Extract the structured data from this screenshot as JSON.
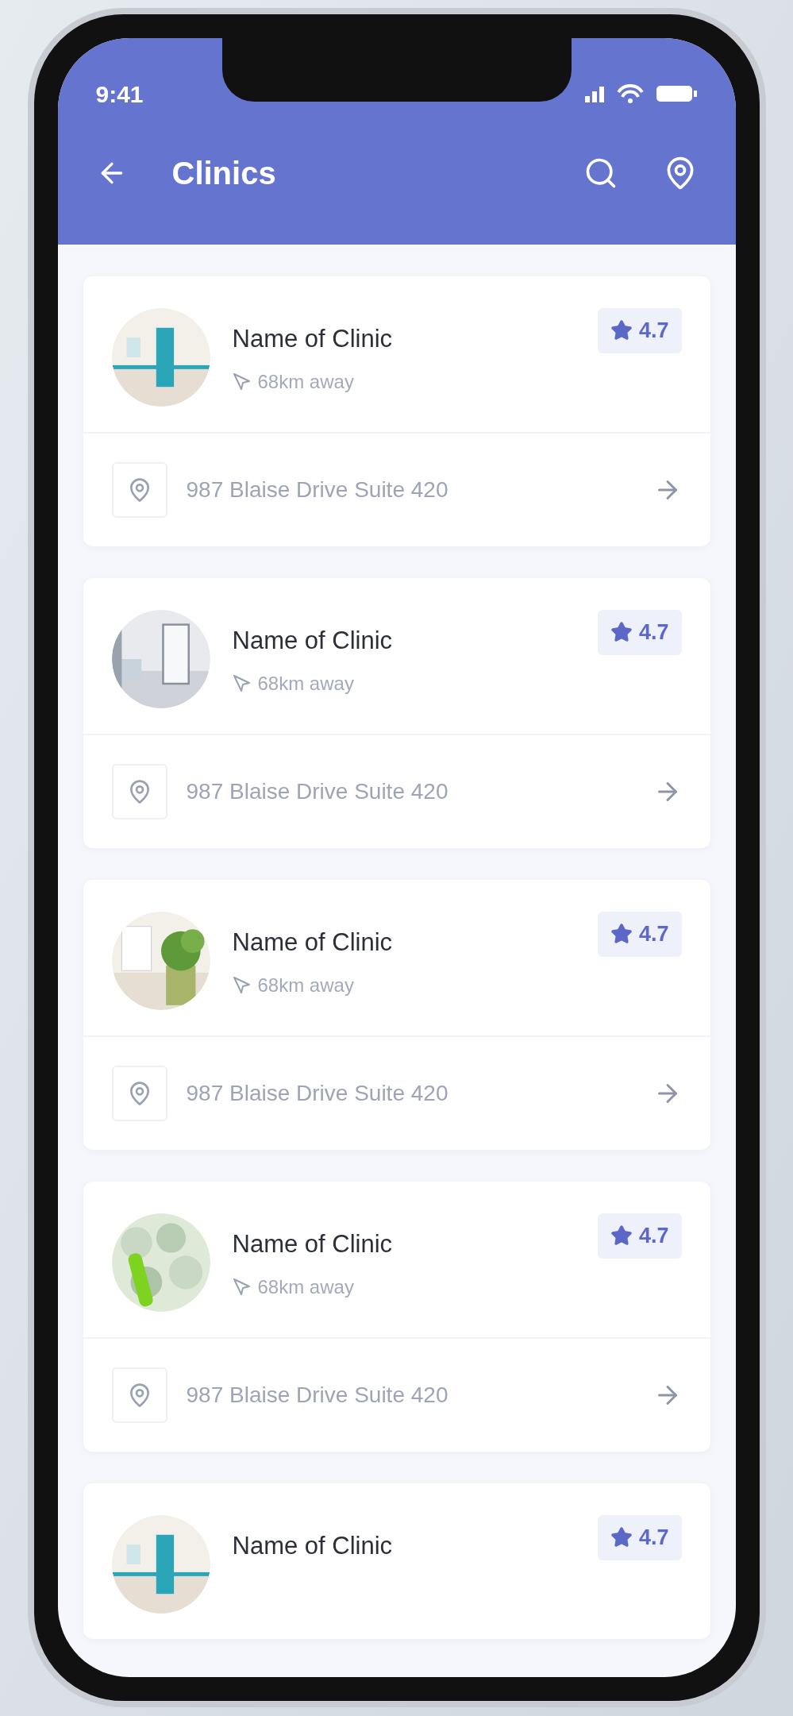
{
  "status_bar": {
    "time": "9:41"
  },
  "header": {
    "title": "Clinics"
  },
  "clinics": [
    {
      "name": "Name of Clinic",
      "rating": "4.7",
      "distance": "68km away",
      "address": "987 Blaise Drive Suite 420"
    },
    {
      "name": "Name of Clinic",
      "rating": "4.7",
      "distance": "68km away",
      "address": "987 Blaise Drive Suite 420"
    },
    {
      "name": "Name of Clinic",
      "rating": "4.7",
      "distance": "68km away",
      "address": "987 Blaise Drive Suite 420"
    },
    {
      "name": "Name of Clinic",
      "rating": "4.7",
      "distance": "68km away",
      "address": "987 Blaise Drive Suite 420"
    },
    {
      "name": "Name of Clinic",
      "rating": "4.7"
    }
  ]
}
